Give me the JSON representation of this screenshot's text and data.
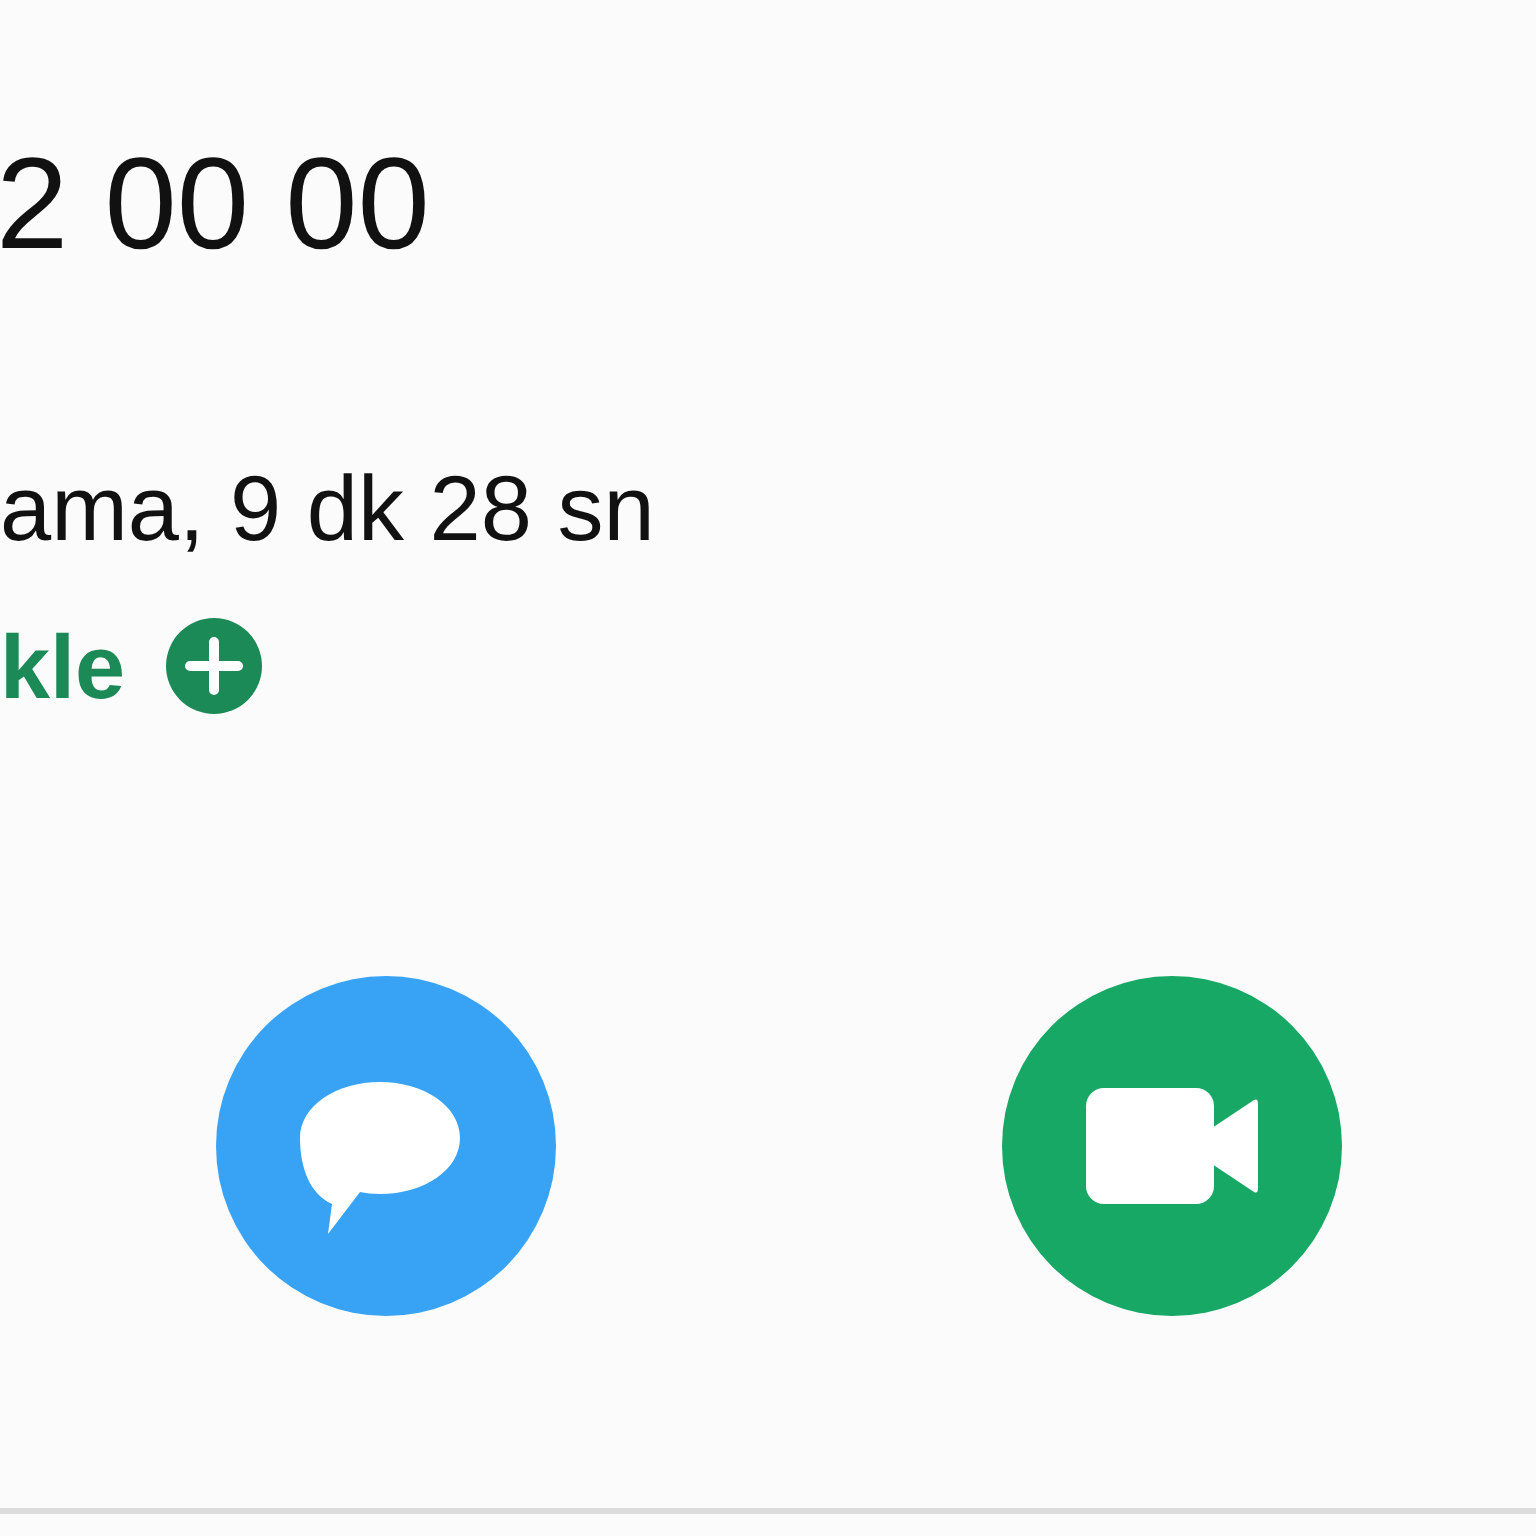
{
  "contact": {
    "phone_number": "2 00 00"
  },
  "call_info": {
    "description": "ama, 9 dk 28 sn"
  },
  "add_action": {
    "label": "kle"
  },
  "actions": [
    {
      "kind": "message"
    },
    {
      "kind": "video"
    }
  ]
}
